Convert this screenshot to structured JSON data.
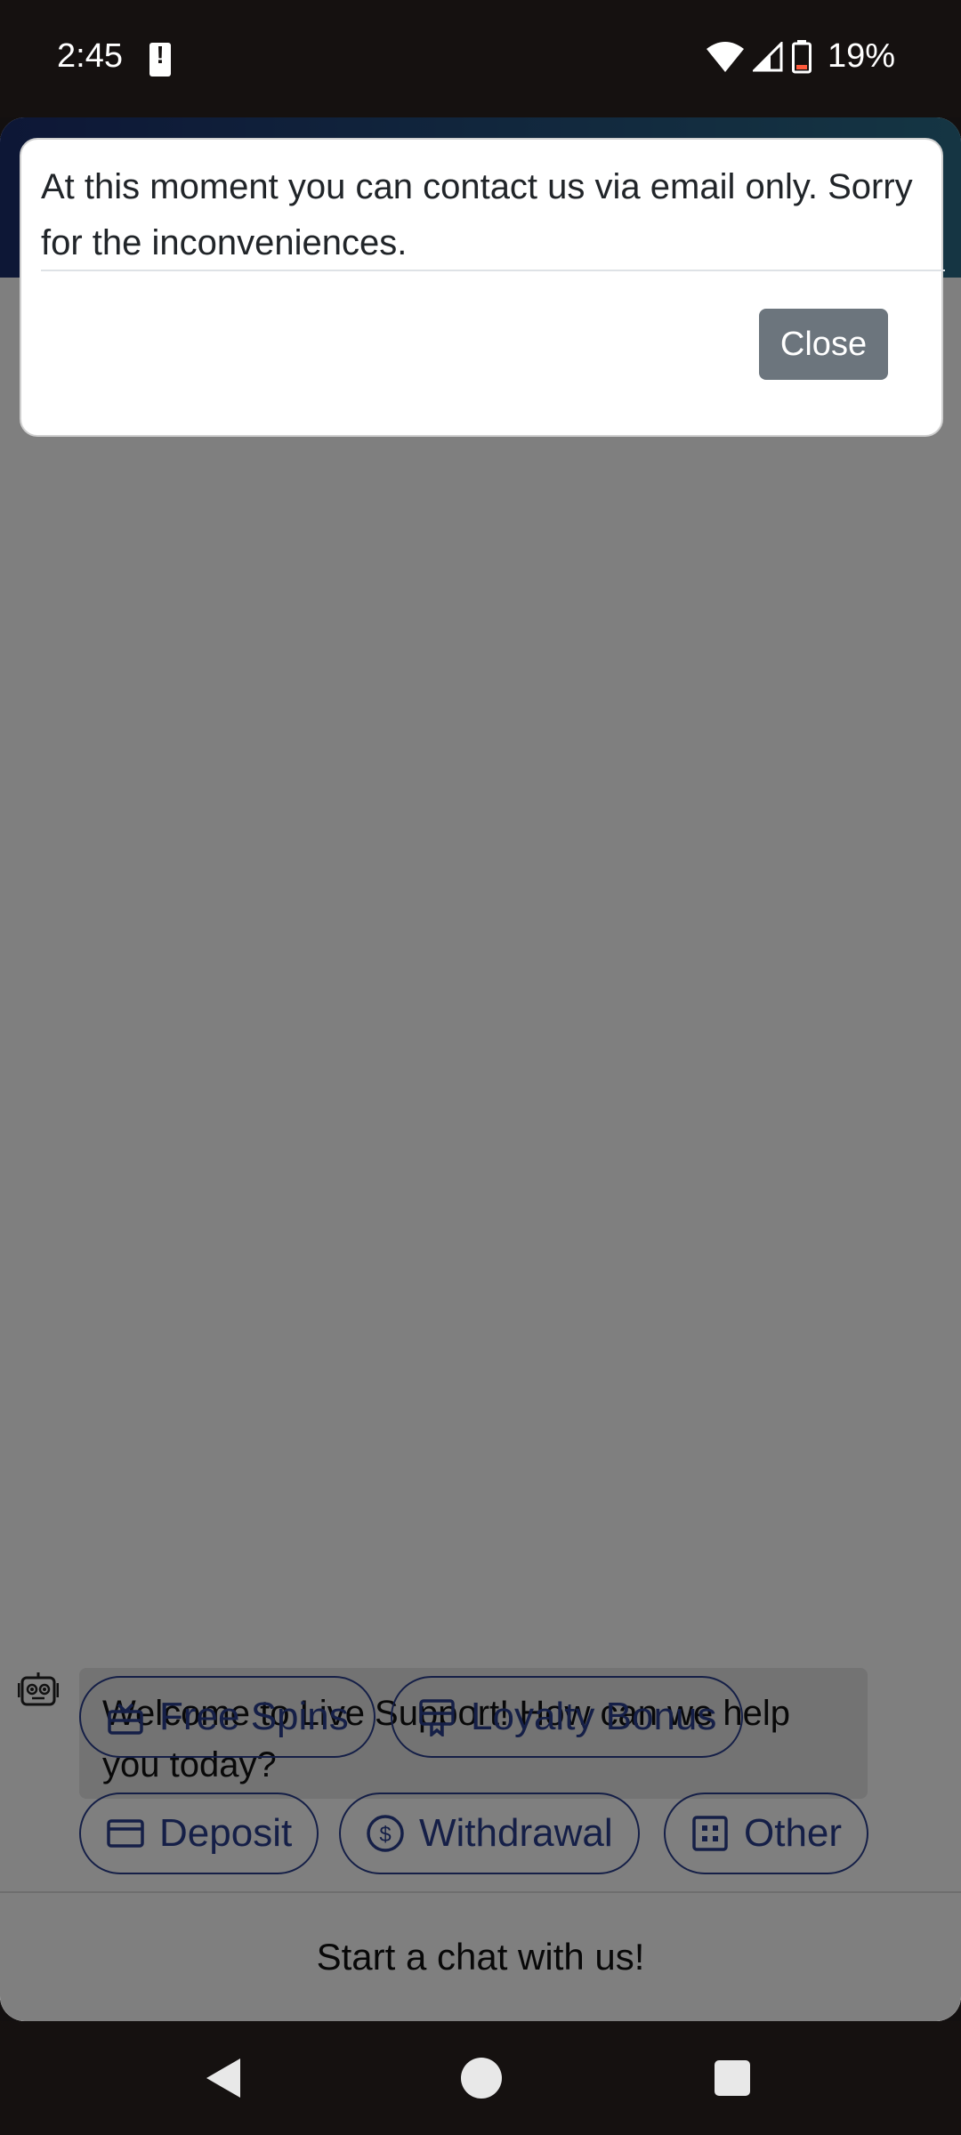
{
  "status_bar": {
    "time": "2:45",
    "battery_percent": "19%"
  },
  "modal": {
    "message": "At this moment you can contact us via email only. Sorry for the inconveniences.",
    "close_label": "Close"
  },
  "chat": {
    "welcome_message": "Welcome to Live Support! How can we help you today?",
    "options": [
      {
        "label": "Free Spins",
        "icon": "gift-icon"
      },
      {
        "label": "Loyalty Bonus",
        "icon": "certificate-icon"
      },
      {
        "label": "Deposit",
        "icon": "credit-card-icon"
      },
      {
        "label": "Withdrawal",
        "icon": "dollar-circle-icon"
      },
      {
        "label": "Other",
        "icon": "grid-icon"
      }
    ],
    "footer_label": "Start a chat with us!"
  },
  "colors": {
    "accent": "#2a3f8f",
    "close_button": "#6c757d",
    "header_gradient_start": "#1b2e6d",
    "header_gradient_end": "#2a6b87"
  }
}
